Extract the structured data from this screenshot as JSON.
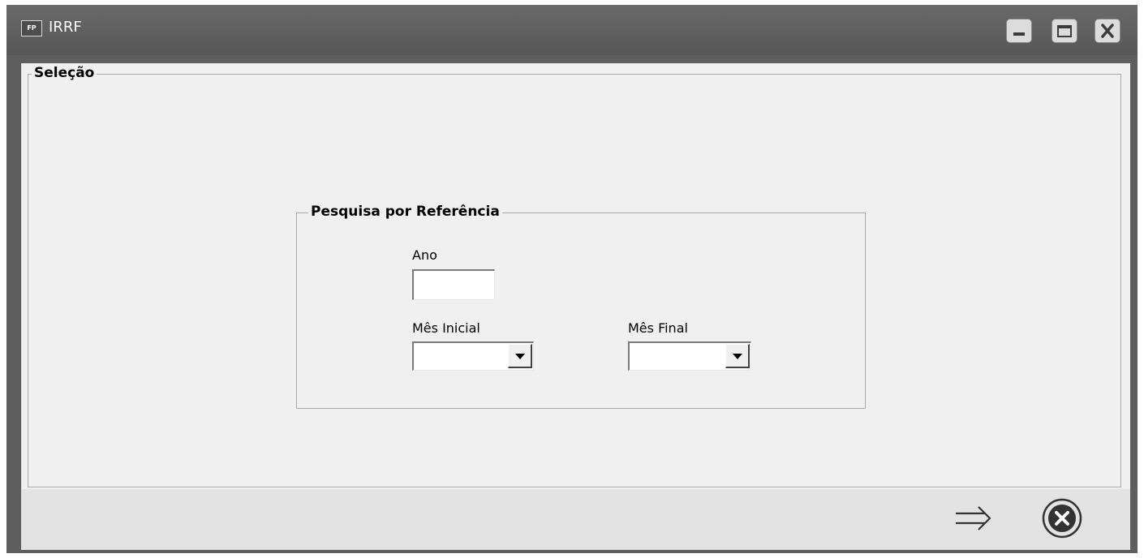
{
  "window": {
    "app_icon_text": "FP",
    "title": "IRRF",
    "controls": {
      "minimize": "minimize-icon",
      "maximize": "maximize-icon",
      "close": "close-icon"
    }
  },
  "selection": {
    "legend": "Seleção",
    "reference": {
      "legend": "Pesquisa por Referência",
      "year": {
        "label": "Ano",
        "value": ""
      },
      "start_month": {
        "label": "Mês Inicial",
        "value": ""
      },
      "end_month": {
        "label": "Mês Final",
        "value": ""
      }
    }
  },
  "footer": {
    "confirm_icon": "arrow-right-icon",
    "cancel_icon": "circle-x-icon"
  },
  "colors": {
    "titlebar": "#5e5e5e",
    "client_bg": "#f0f0f0",
    "footer_bg": "#e3e3e3"
  }
}
